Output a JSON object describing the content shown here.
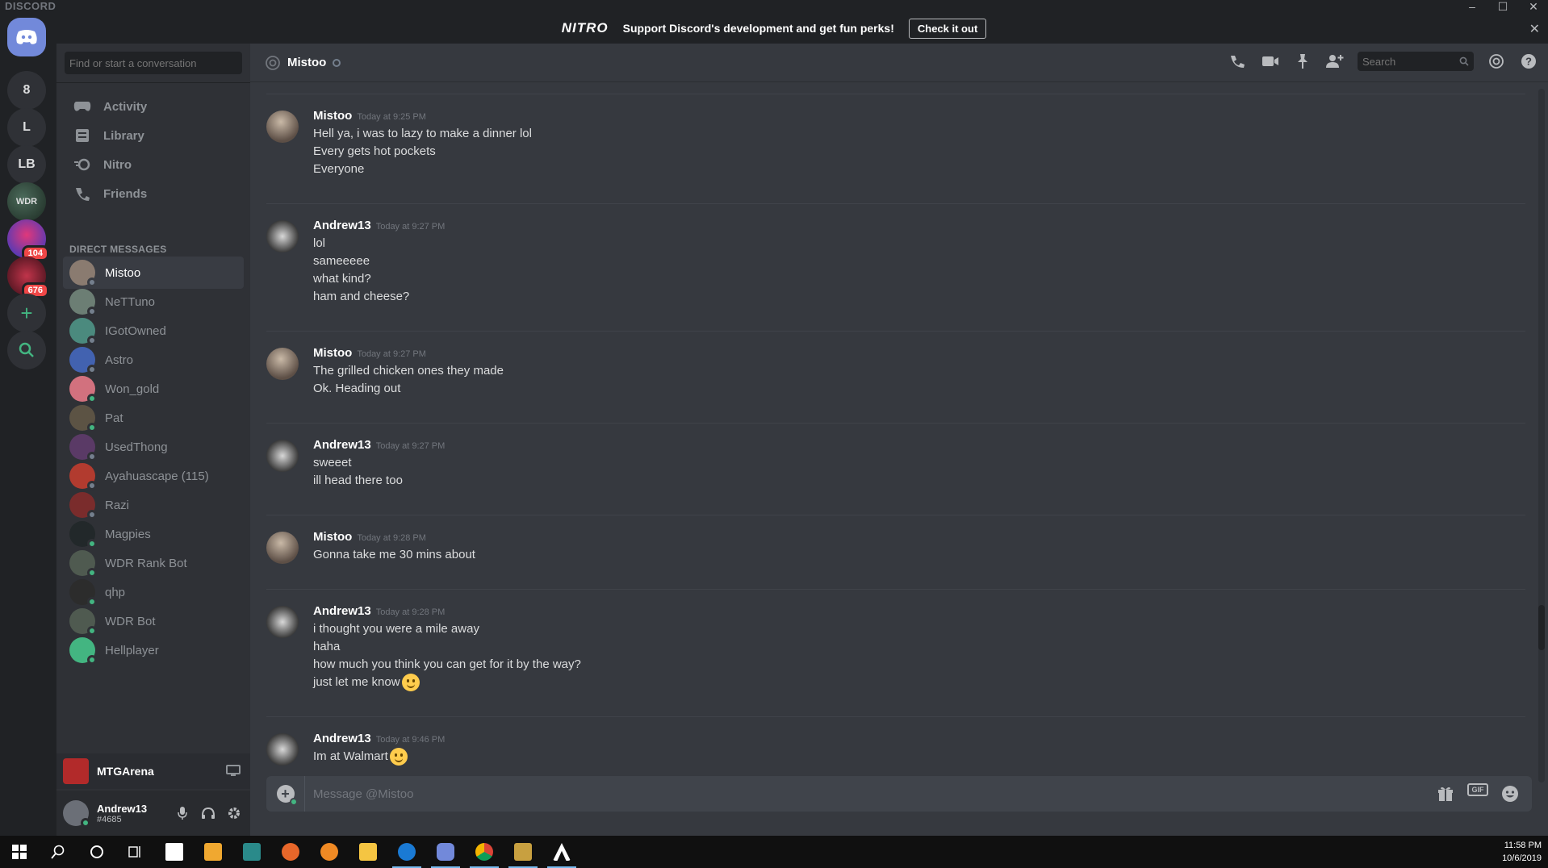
{
  "window": {
    "brand": "DISCORD",
    "controls": [
      "–",
      "☐",
      "✕"
    ]
  },
  "banner": {
    "logo": "NITRO",
    "text": "Support Discord's development and get fun perks!",
    "button": "Check it out",
    "close": "✕"
  },
  "guilds": [
    {
      "label": ""
    },
    {
      "label": "8"
    },
    {
      "label": "L"
    },
    {
      "label": "LB"
    },
    {
      "label": "WDR"
    },
    {
      "label": "",
      "badge": "104"
    },
    {
      "label": "",
      "badge": "676"
    }
  ],
  "sidebar": {
    "search_placeholder": "Find or start a conversation",
    "nav": [
      {
        "label": "Activity",
        "icon": "controller-icon"
      },
      {
        "label": "Library",
        "icon": "library-icon"
      },
      {
        "label": "Nitro",
        "icon": "nitro-icon"
      },
      {
        "label": "Friends",
        "icon": "friends-icon"
      }
    ],
    "dm_header": "DIRECT MESSAGES",
    "dms": [
      {
        "name": "Mistoo",
        "status": "offline",
        "color": "#8a7b70"
      },
      {
        "name": "NeTTuno",
        "status": "offline",
        "color": "#6c7e74"
      },
      {
        "name": "IGotOwned",
        "status": "offline",
        "color": "#4b8a7e"
      },
      {
        "name": "Astro",
        "status": "offline",
        "color": "#4262b0"
      },
      {
        "name": "Won_gold",
        "status": "online",
        "color": "#d2717e"
      },
      {
        "name": "Pat",
        "status": "online",
        "color": "#5c5344"
      },
      {
        "name": "UsedThong",
        "status": "offline",
        "color": "#5a3a66"
      },
      {
        "name": "Ayahuascape (115)",
        "status": "offline",
        "color": "#b23b2f"
      },
      {
        "name": "Razi",
        "status": "offline",
        "color": "#7a2c2c"
      },
      {
        "name": "Magpies",
        "status": "online",
        "color": "#22282a"
      },
      {
        "name": "WDR Rank Bot",
        "status": "online",
        "color": "#4f5a50"
      },
      {
        "name": "qhp",
        "status": "online",
        "color": "#2c2c2c"
      },
      {
        "name": "WDR Bot",
        "status": "online",
        "color": "#4f5a50"
      },
      {
        "name": "Hellplayer",
        "status": "online",
        "color": "#43b581"
      }
    ],
    "game": {
      "name": "MTGArena"
    },
    "user": {
      "name": "Andrew13",
      "tag": "#4685"
    }
  },
  "chat": {
    "title": "Mistoo",
    "search_placeholder": "Search",
    "input_placeholder": "Message @Mistoo",
    "groups": [
      {
        "author": "Mistoo",
        "avatar": "mistoo",
        "time": "Today at 9:25 PM",
        "lines": [
          {
            "t": "Hell ya, i was to lazy to make a dinner lol"
          },
          {
            "t": "Every gets hot pockets"
          },
          {
            "t": "Everyone"
          }
        ]
      },
      {
        "author": "Andrew13",
        "avatar": "andrew",
        "time": "Today at 9:27 PM",
        "lines": [
          {
            "t": "lol"
          },
          {
            "t": "sameeeee"
          },
          {
            "t": "what kind?"
          },
          {
            "t": "ham and cheese?"
          }
        ]
      },
      {
        "author": "Mistoo",
        "avatar": "mistoo",
        "time": "Today at 9:27 PM",
        "lines": [
          {
            "t": "The grilled chicken ones they made"
          },
          {
            "t": "Ok. Heading out"
          }
        ]
      },
      {
        "author": "Andrew13",
        "avatar": "andrew",
        "time": "Today at 9:27 PM",
        "lines": [
          {
            "t": "sweeet"
          },
          {
            "t": "ill head there too"
          }
        ]
      },
      {
        "author": "Mistoo",
        "avatar": "mistoo",
        "time": "Today at 9:28 PM",
        "lines": [
          {
            "t": "Gonna take me 30 mins about"
          }
        ]
      },
      {
        "author": "Andrew13",
        "avatar": "andrew",
        "time": "Today at 9:28 PM",
        "lines": [
          {
            "t": "i thought you were a mile away"
          },
          {
            "t": "haha"
          },
          {
            "t": "how much you think you can get for it by the way?"
          },
          {
            "t": "just let me know",
            "emoji": true
          }
        ]
      },
      {
        "author": "Andrew13",
        "avatar": "andrew",
        "time": "Today at 9:46 PM",
        "lines": [
          {
            "t": "Im at Walmart",
            "emoji": true
          }
        ]
      }
    ]
  },
  "taskbar": {
    "time": "11:58 PM",
    "date": "10/6/2019"
  }
}
